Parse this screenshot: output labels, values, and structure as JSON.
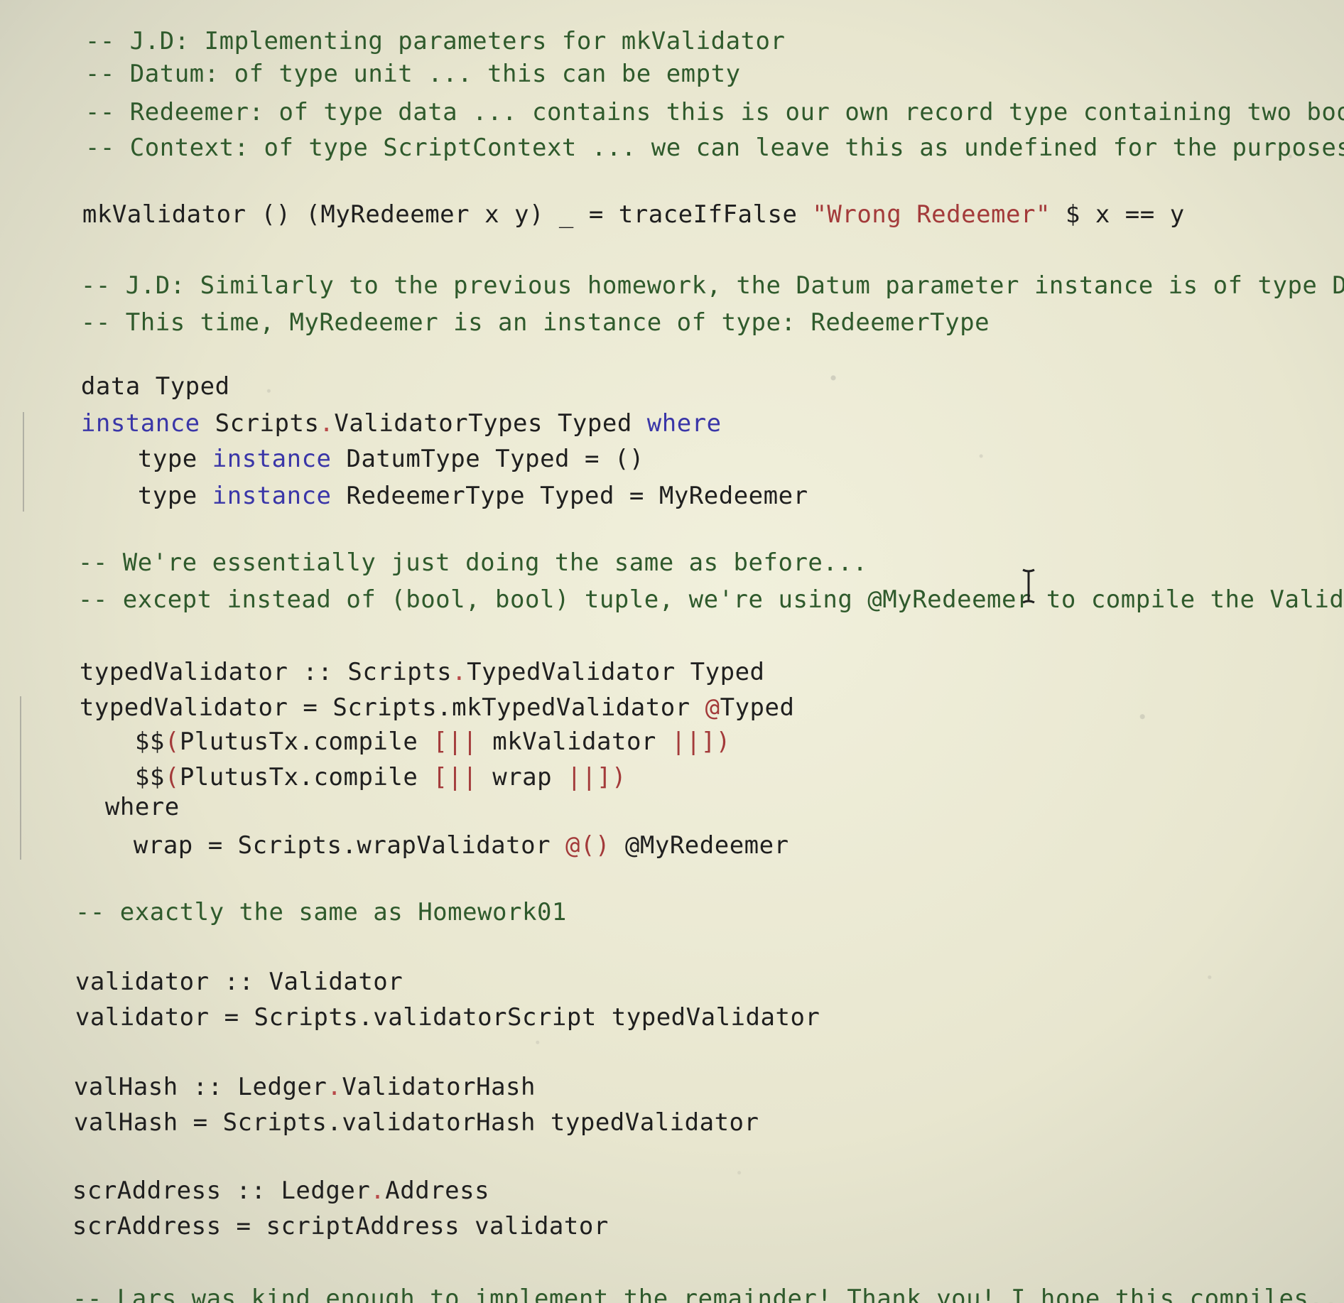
{
  "code": {
    "lines": {
      "l1_a": "-- J.D: Implementing parameters for mkValidator",
      "l2_a": "-- Datum: of type unit ... this can be empty",
      "l3_a": "-- Redeemer: of type data ... contains this is our own record type containing two bools",
      "l4_a": "-- Context: of type ScriptContext ... we can leave this as undefined for the purposes of this",
      "l5_a": "mkValidator () (MyRedeemer x y) _ = traceIfFalse ",
      "l5_b": "\"Wrong Redeemer\"",
      "l5_c": " $ x == y",
      "l6_a": "-- J.D: Similarly to the previous homework, the Datum parameter instance is of type DatumType,",
      "l7_a": "-- This time, MyRedeemer is an instance of type: RedeemerType",
      "l8_a": "data Typed",
      "l9_kw1": "instance",
      "l9_a": " Scripts",
      "l9_dot": ".",
      "l9_b": "ValidatorTypes Typed ",
      "l9_kw2": "where",
      "l10_a": "type ",
      "l10_kw": "instance",
      "l10_b": " DatumType Typed = ()",
      "l11_a": "type ",
      "l11_kw": "instance",
      "l11_b": " RedeemerType Typed = MyRedeemer",
      "l12_a": "-- We're essentially just doing the same as before...",
      "l13_a": "-- except instead of (bool, bool) tuple, we're using @MyRedeemer to compile the Validator",
      "l14_a": "typedValidator :: Scripts",
      "l14_dot": ".",
      "l14_b": "TypedValidator Typed",
      "l15_a": "typedValidator = Scripts.mkTypedValidator ",
      "l15_red": "@",
      "l15_b": "Typed",
      "l16_a": "$$",
      "l16_red1": "(",
      "l16_b": "PlutusTx.compile ",
      "l16_red2": "[||",
      "l16_c": " mkValidator ",
      "l16_red3": "||])",
      "l17_a": "$$",
      "l17_red1": "(",
      "l17_b": "PlutusTx.compile ",
      "l17_red2": "[||",
      "l17_c": " wrap ",
      "l17_red3": "||])",
      "l18_a": "where",
      "l19_a": "wrap = Scripts.wrapValidator ",
      "l19_red": "@()",
      "l19_b": " @MyRedeemer",
      "l20_a": "-- exactly the same as Homework01",
      "l21_a": "validator :: Validator",
      "l22_a": "validator = Scripts.validatorScript typedValidator",
      "l23_a": "valHash :: Ledger",
      "l23_dot": ".",
      "l23_b": "ValidatorHash",
      "l24_a": "valHash = Scripts.validatorHash typedValidator",
      "l25_a": "scrAddress :: Ledger",
      "l25_dot": ".",
      "l25_b": "Address",
      "l26_a": "scrAddress = scriptAddress validator",
      "l27_a": "-- Lars was kind enough to implement the remainder! Thank you! I hope this compiles..."
    }
  },
  "icons": {
    "cursor": "text-cursor-icon"
  },
  "colors": {
    "background": "#e8e6cf",
    "comment": "#2f5a2c",
    "keyword": "#3a36a8",
    "string": "#a33a3a"
  }
}
